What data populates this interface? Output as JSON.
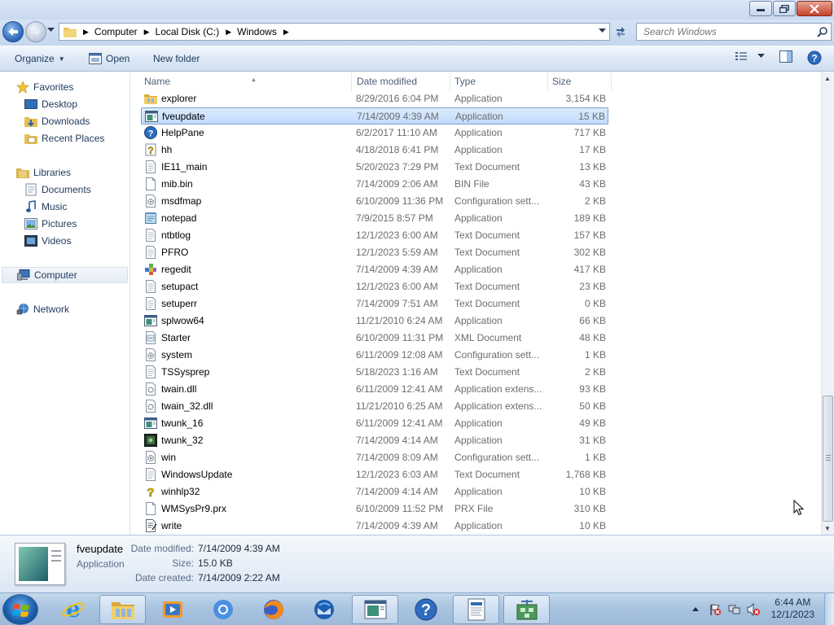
{
  "window": {
    "controls": {
      "minimize": "minimize",
      "maximize": "restore",
      "close": "close"
    }
  },
  "address": {
    "crumbs": [
      "Computer",
      "Local Disk (C:)",
      "Windows"
    ],
    "search_placeholder": "Search Windows"
  },
  "toolbar": {
    "organize": "Organize",
    "open": "Open",
    "new_folder": "New folder"
  },
  "nav": {
    "favorites": "Favorites",
    "desktop": "Desktop",
    "downloads": "Downloads",
    "recent_places": "Recent Places",
    "libraries": "Libraries",
    "documents": "Documents",
    "music": "Music",
    "pictures": "Pictures",
    "videos": "Videos",
    "computer": "Computer",
    "network": "Network"
  },
  "columns": {
    "name": "Name",
    "date_modified": "Date modified",
    "type": "Type",
    "size": "Size"
  },
  "files": [
    {
      "name": "explorer",
      "date": "8/29/2016 6:04 PM",
      "type": "Application",
      "size": "3,154 KB",
      "icon": "explorer-icon"
    },
    {
      "name": "fveupdate",
      "date": "7/14/2009 4:39 AM",
      "type": "Application",
      "size": "15 KB",
      "icon": "app-window-icon"
    },
    {
      "name": "HelpPane",
      "date": "6/2/2017 11:10 AM",
      "type": "Application",
      "size": "717 KB",
      "icon": "help-icon"
    },
    {
      "name": "hh",
      "date": "4/18/2018 6:41 PM",
      "type": "Application",
      "size": "17 KB",
      "icon": "help-file-icon"
    },
    {
      "name": "IE11_main",
      "date": "5/20/2023 7:29 PM",
      "type": "Text Document",
      "size": "13 KB",
      "icon": "text-file-icon"
    },
    {
      "name": "mib.bin",
      "date": "7/14/2009 2:06 AM",
      "type": "BIN File",
      "size": "43 KB",
      "icon": "blank-file-icon"
    },
    {
      "name": "msdfmap",
      "date": "6/10/2009 11:36 PM",
      "type": "Configuration sett...",
      "size": "2 KB",
      "icon": "config-file-icon"
    },
    {
      "name": "notepad",
      "date": "7/9/2015 8:57 PM",
      "type": "Application",
      "size": "189 KB",
      "icon": "notepad-icon"
    },
    {
      "name": "ntbtlog",
      "date": "12/1/2023 6:00 AM",
      "type": "Text Document",
      "size": "157 KB",
      "icon": "text-file-icon"
    },
    {
      "name": "PFRO",
      "date": "12/1/2023 5:59 AM",
      "type": "Text Document",
      "size": "302 KB",
      "icon": "text-file-icon"
    },
    {
      "name": "regedit",
      "date": "7/14/2009 4:39 AM",
      "type": "Application",
      "size": "417 KB",
      "icon": "regedit-icon"
    },
    {
      "name": "setupact",
      "date": "12/1/2023 6:00 AM",
      "type": "Text Document",
      "size": "23 KB",
      "icon": "text-file-icon"
    },
    {
      "name": "setuperr",
      "date": "7/14/2009 7:51 AM",
      "type": "Text Document",
      "size": "0 KB",
      "icon": "text-file-icon"
    },
    {
      "name": "splwow64",
      "date": "11/21/2010 6:24 AM",
      "type": "Application",
      "size": "66 KB",
      "icon": "app-window-icon"
    },
    {
      "name": "Starter",
      "date": "6/10/2009 11:31 PM",
      "type": "XML Document",
      "size": "48 KB",
      "icon": "xml-file-icon"
    },
    {
      "name": "system",
      "date": "6/11/2009 12:08 AM",
      "type": "Configuration sett...",
      "size": "1 KB",
      "icon": "config-file-icon"
    },
    {
      "name": "TSSysprep",
      "date": "5/18/2023 1:16 AM",
      "type": "Text Document",
      "size": "2 KB",
      "icon": "text-file-icon"
    },
    {
      "name": "twain.dll",
      "date": "6/11/2009 12:41 AM",
      "type": "Application extens...",
      "size": "93 KB",
      "icon": "dll-file-icon"
    },
    {
      "name": "twain_32.dll",
      "date": "11/21/2010 6:25 AM",
      "type": "Application extens...",
      "size": "50 KB",
      "icon": "dll-file-icon"
    },
    {
      "name": "twunk_16",
      "date": "6/11/2009 12:41 AM",
      "type": "Application",
      "size": "49 KB",
      "icon": "app-window-icon"
    },
    {
      "name": "twunk_32",
      "date": "7/14/2009 4:14 AM",
      "type": "Application",
      "size": "31 KB",
      "icon": "scanner-app-icon"
    },
    {
      "name": "win",
      "date": "7/14/2009 8:09 AM",
      "type": "Configuration sett...",
      "size": "1 KB",
      "icon": "config-file-icon"
    },
    {
      "name": "WindowsUpdate",
      "date": "12/1/2023 6:03 AM",
      "type": "Text Document",
      "size": "1,768 KB",
      "icon": "text-file-icon"
    },
    {
      "name": "winhlp32",
      "date": "7/14/2009 4:14 AM",
      "type": "Application",
      "size": "10 KB",
      "icon": "help-question-icon"
    },
    {
      "name": "WMSysPr9.prx",
      "date": "6/10/2009 11:52 PM",
      "type": "PRX File",
      "size": "310 KB",
      "icon": "blank-file-icon"
    },
    {
      "name": "write",
      "date": "7/14/2009 4:39 AM",
      "type": "Application",
      "size": "10 KB",
      "icon": "wordpad-icon"
    }
  ],
  "selected_index": 1,
  "details": {
    "name": "fveupdate",
    "type": "Application",
    "modified_label": "Date modified:",
    "modified": "7/14/2009 4:39 AM",
    "size_label": "Size:",
    "size": "15.0 KB",
    "created_label": "Date created:",
    "created": "7/14/2009 2:22 AM"
  },
  "taskbar": {
    "apps": [
      "internet-explorer-icon",
      "file-explorer-icon",
      "media-player-icon",
      "chrome-icon",
      "firefox-icon",
      "thunderbird-icon",
      "app-window-icon",
      "help-icon",
      "document-viewer-icon",
      "network-app-icon"
    ],
    "active_app": "file-explorer-icon",
    "time": "6:44 AM",
    "date": "12/1/2023"
  },
  "colors": {
    "selection_bg": "#cce4fc",
    "selection_border": "#7da2ce",
    "link_text": "#1e395b"
  }
}
